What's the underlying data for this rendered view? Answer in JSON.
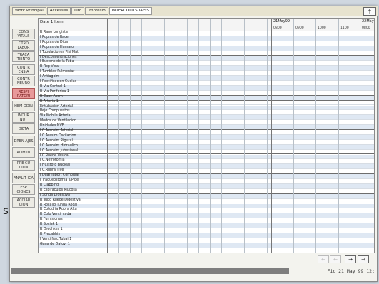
{
  "stray_text": "s",
  "tabs": [
    {
      "label": "Work Principal",
      "active": false
    },
    {
      "label": "Accesses",
      "active": false
    },
    {
      "label": "Ord",
      "active": false
    },
    {
      "label": "Impresio",
      "active": false
    },
    {
      "label": "INTERCOOTS IA/SS",
      "active": true
    }
  ],
  "corner_button": "↑",
  "sidebar": [
    {
      "label": "CONS VITALS",
      "active": false
    },
    {
      "label": "CTRD LABOR",
      "active": false
    },
    {
      "label": "TRACA TIENTO",
      "active": false
    },
    {
      "label": "CONTR ENSIA",
      "active": false
    },
    {
      "label": "CONTR NEURO",
      "active": false
    },
    {
      "label": "RESPI RATORI",
      "active": true
    },
    {
      "label": "HEM ODIN",
      "active": false
    },
    {
      "label": "INDUR NUT",
      "active": false
    },
    {
      "label": "DIETA",
      "active": false
    },
    {
      "label": "DREN AJES",
      "active": false
    },
    {
      "label": "ALIM IN",
      "active": false
    },
    {
      "label": "PRE CU CION",
      "active": false
    },
    {
      "label": "ANALIT ICA",
      "active": false
    },
    {
      "label": "ESP CIONES",
      "active": false
    },
    {
      "label": "ACCIAR CION",
      "active": false
    }
  ],
  "header": {
    "item_col": "Date 1 Item",
    "date_cols": [
      {
        "date": "21May99",
        "time": "0800"
      },
      {
        "date": "",
        "time": "0900"
      },
      {
        "date": "",
        "time": "1000"
      },
      {
        "date": "",
        "time": "1100"
      },
      {
        "date": "22May99",
        "time": "0800"
      }
    ]
  },
  "rows": [
    "R Rano Longista",
    "I Ruplas de Race",
    "I Ruplas de Diua",
    "I Ruplas de Humaro",
    "I Tubulaciones Pisi Mat",
    "I Desconcentraciones",
    "I Eucions de la Tuba",
    "R Rep-Vidal",
    "I Tumblas Pulmoniar",
    "I Antiagolm",
    "I Rectificacion Cuelas",
    "R Via Central 1",
    "R Via Periferica 1",
    "R Cuac-Asom",
    "R Arteria 1",
    "  Entubacion Arterial",
    "  Rejo Compuestos",
    "  Via Mobile Arterial",
    "  Modos de Ventilacion",
    "  Unidades NVE",
    "I C.Aerosim Arterial",
    "I C.Arasim Oscilacion",
    "I C.Aerosim Rigural",
    "I C.Aerosim Hidraulico",
    "I C.Aerosim Jubesianal",
    "I C.Ruede Vesical",
    "I C.Nefrotomia",
    "I F.Cistoto Bucleal",
    "I C.Rupra Tive",
    "I Dual Tubo(t Compleal",
    "I Traqueostomia s/Pipe",
    "R Clapping",
    "R Espiraculos Mucosa",
    "I Sonda Digestiva",
    "R Tubo Ruede Digestiva",
    "R Rocalio Tunda Rocal",
    "R Cotodria Ruora Alta",
    "R Colo Ventil cada",
    "R Fumisiones",
    "R Sociak 1",
    "R Drechkes 1",
    "R Precabhis",
    "I Ventilfrac Tubai 1",
    "  Gana de Datovi 1"
  ],
  "separators_after": [
    4,
    12,
    13,
    19,
    24,
    28,
    32,
    36,
    41
  ],
  "nav_buttons": [
    "⇐",
    "⇐",
    "→",
    "⇒"
  ],
  "status_date": "Fic 21 May 99  12:"
}
